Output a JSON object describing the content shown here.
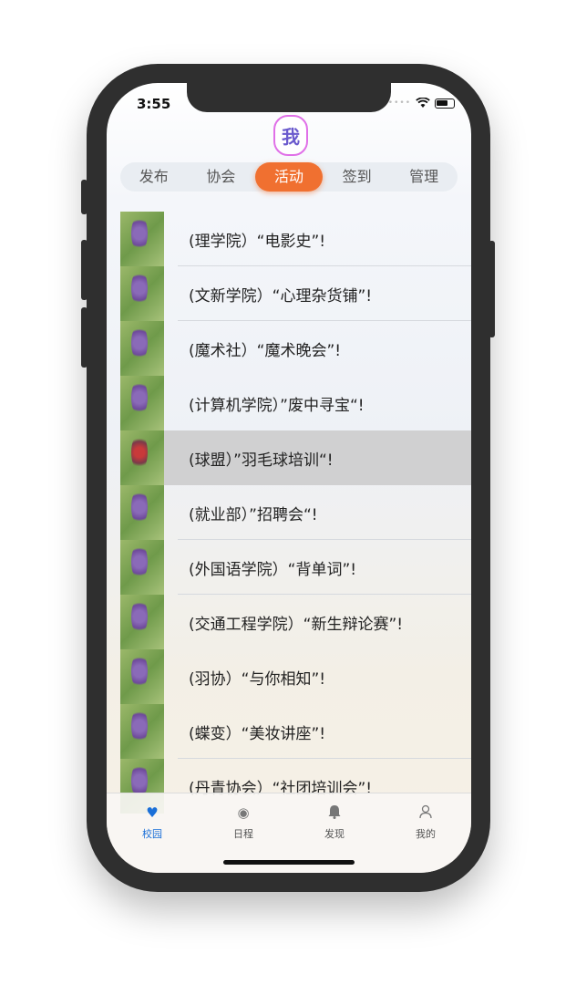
{
  "status": {
    "time": "3:55"
  },
  "avatar": {
    "text": "我"
  },
  "segments": [
    {
      "label": "发布"
    },
    {
      "label": "协会"
    },
    {
      "label": "活动"
    },
    {
      "label": "签到"
    },
    {
      "label": "管理"
    }
  ],
  "active_segment": "活动",
  "activities": [
    {
      "title": "(理学院）“电影史”!"
    },
    {
      "title": "(文新学院）“心理杂货铺”!"
    },
    {
      "title": "(魔术社）“魔术晚会”!"
    },
    {
      "title": "(计算机学院）”废中寻宝“!"
    },
    {
      "title": "(球盟）”羽毛球培训“!"
    },
    {
      "title": "(就业部）”招聘会“!"
    },
    {
      "title": "(外国语学院）“背单词”!"
    },
    {
      "title": "(交通工程学院）“新生辩论赛”!"
    },
    {
      "title": "(羽协）“与你相知”!"
    },
    {
      "title": "(蝶变）“美妆讲座”!"
    },
    {
      "title": "(丹青协会）“社团培训会”!"
    }
  ],
  "selected_row": 4,
  "tabbar": [
    {
      "label": "校园",
      "icon": "heart-icon"
    },
    {
      "label": "日程",
      "icon": "record-icon"
    },
    {
      "label": "发现",
      "icon": "bell-icon"
    },
    {
      "label": "我的",
      "icon": "person-icon"
    }
  ],
  "active_tab": "校园",
  "colors": {
    "accent": "#f07030",
    "tab_active": "#1a6fd8"
  }
}
